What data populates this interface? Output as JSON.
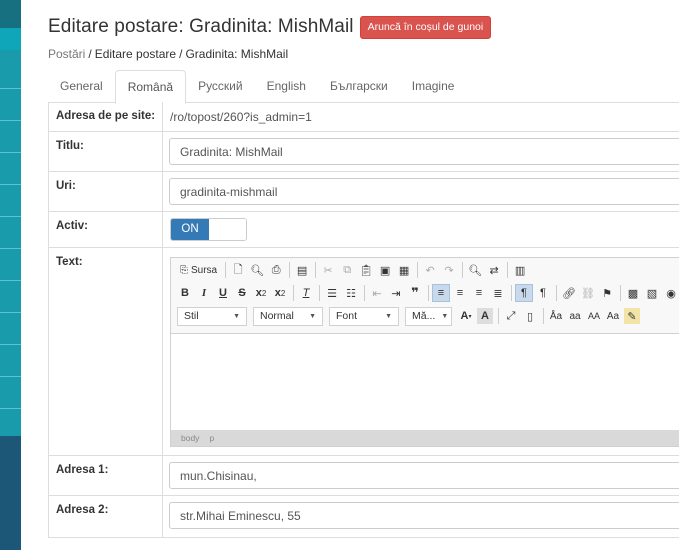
{
  "header": {
    "title": "Editare postare: Gradinita: MishMail",
    "trash_button": "Aruncă în coșul de gunoi"
  },
  "breadcrumb": {
    "items": [
      "Postări",
      "Editare postare",
      "Gradinita: MishMail"
    ],
    "separator": "/"
  },
  "tabs": [
    {
      "label": "General",
      "active": false
    },
    {
      "label": "Română",
      "active": true
    },
    {
      "label": "Русский",
      "active": false
    },
    {
      "label": "English",
      "active": false
    },
    {
      "label": "Български",
      "active": false
    },
    {
      "label": "Imagine",
      "active": false
    }
  ],
  "form": {
    "site_address": {
      "label": "Adresa de pe site:",
      "value": "/ro/topost/260?is_admin=1"
    },
    "title": {
      "label": "Titlu:",
      "value": "Gradinita: MishMail"
    },
    "url": {
      "label": "Uri:",
      "value": "gradinita-mishmail"
    },
    "active": {
      "label": "Activ:",
      "toggle_label": "ON",
      "value": true
    },
    "text": {
      "label": "Text:"
    },
    "address1": {
      "label": "Adresa 1:",
      "value": "mun.Chisinau,"
    },
    "address2": {
      "label": "Adresa 2:",
      "value": "str.Mihai Eminescu, 55"
    }
  },
  "editor": {
    "source_label": "Sursa",
    "combos": {
      "style": "Stil",
      "format": "Normal",
      "font": "Font",
      "size": "Mă..."
    },
    "path": [
      "body",
      "p"
    ]
  },
  "colors": {
    "danger": "#d9534f",
    "primary": "#337ab7",
    "sidebar": "#1a9bab"
  }
}
